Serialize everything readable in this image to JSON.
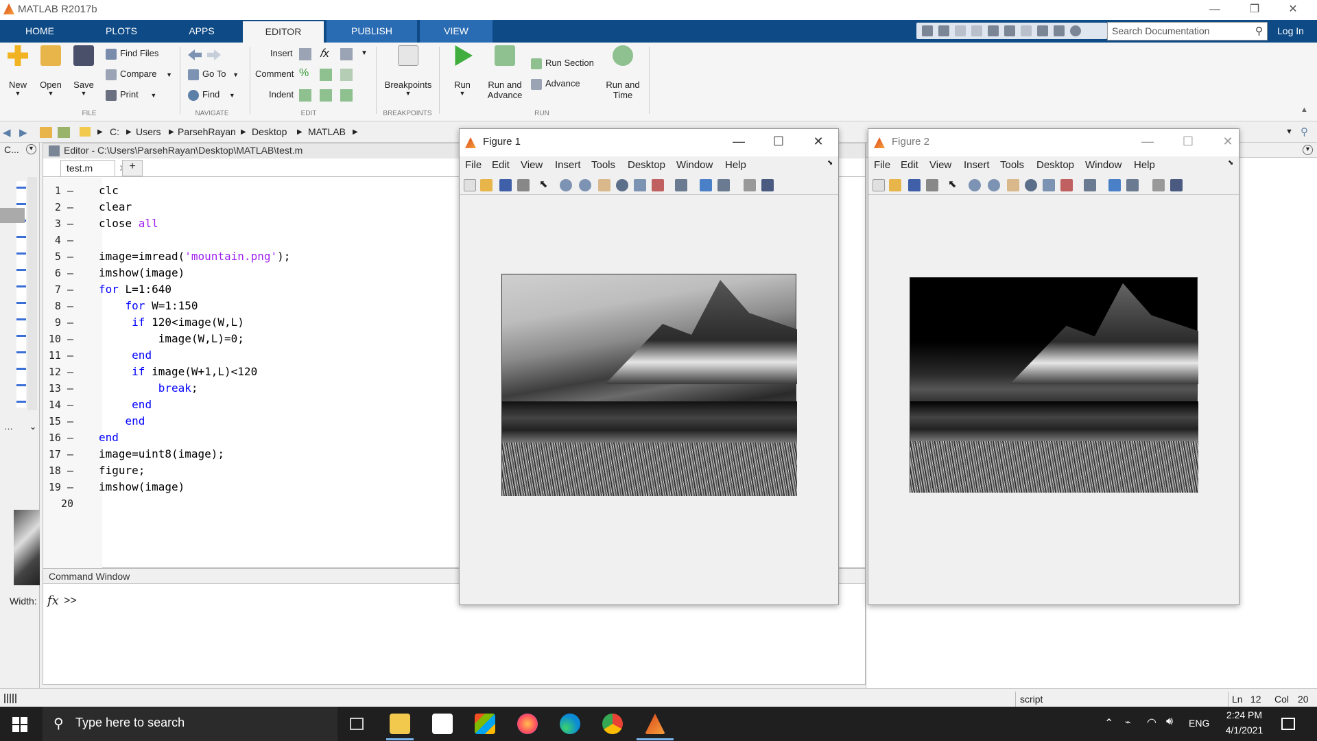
{
  "app": {
    "title": "MATLAB R2017b"
  },
  "tabs": [
    "HOME",
    "PLOTS",
    "APPS",
    "EDITOR",
    "PUBLISH",
    "VIEW"
  ],
  "search": {
    "placeholder": "Search Documentation"
  },
  "login": "Log In",
  "ribbon": {
    "file": {
      "new": "New",
      "open": "Open",
      "save": "Save",
      "find_files": "Find Files",
      "compare": "Compare",
      "print": "Print",
      "group": "FILE"
    },
    "navigate": {
      "go_to": "Go To",
      "find": "Find",
      "group": "NAVIGATE"
    },
    "edit": {
      "insert": "Insert",
      "comment": "Comment",
      "indent": "Indent",
      "group": "EDIT"
    },
    "breakpoints": {
      "label": "Breakpoints",
      "group": "BREAKPOINTS"
    },
    "run": {
      "run": "Run",
      "run_and_advance_1": "Run and",
      "run_and_advance_2": "Advance",
      "run_section": "Run Section",
      "advance": "Advance",
      "run_and_time_1": "Run and",
      "run_and_time_2": "Time",
      "group": "RUN"
    }
  },
  "address": [
    "C:",
    "Users",
    "ParsehRayan",
    "Desktop",
    "MATLAB"
  ],
  "left_panel": {
    "label": "C...",
    "width_label": "Width:"
  },
  "editor": {
    "header": "Editor - C:\\Users\\ParsehRayan\\Desktop\\MATLAB\\test.m",
    "file_tab": "test.m",
    "lines": [
      "clc",
      "clear",
      "close all",
      "",
      "image=imread('mountain.png');",
      "imshow(image)",
      "for L=1:640",
      "    for W=1:150",
      "     if 120<image(W,L)",
      "         image(W,L)=0;",
      "     end",
      "     if image(W+1,L)<120",
      "         break;",
      "     end",
      "    end",
      "end",
      "image=uint8(image);",
      "figure;",
      "imshow(image)",
      ""
    ]
  },
  "command_window": {
    "title": "Command Window",
    "prompt": ">>",
    "fx": "fx"
  },
  "figure1": {
    "title": "Figure 1",
    "menu": [
      "File",
      "Edit",
      "View",
      "Insert",
      "Tools",
      "Desktop",
      "Window",
      "Help"
    ]
  },
  "figure2": {
    "title": "Figure 2",
    "menu": [
      "File",
      "Edit",
      "View",
      "Insert",
      "Tools",
      "Desktop",
      "Window",
      "Help"
    ]
  },
  "status": {
    "mode": "script",
    "ln_label": "Ln",
    "ln": "12",
    "col_label": "Col",
    "col": "20"
  },
  "taskbar": {
    "search": "Type here to search",
    "lang": "ENG",
    "time": "2:24 PM",
    "date": "4/1/2021"
  }
}
